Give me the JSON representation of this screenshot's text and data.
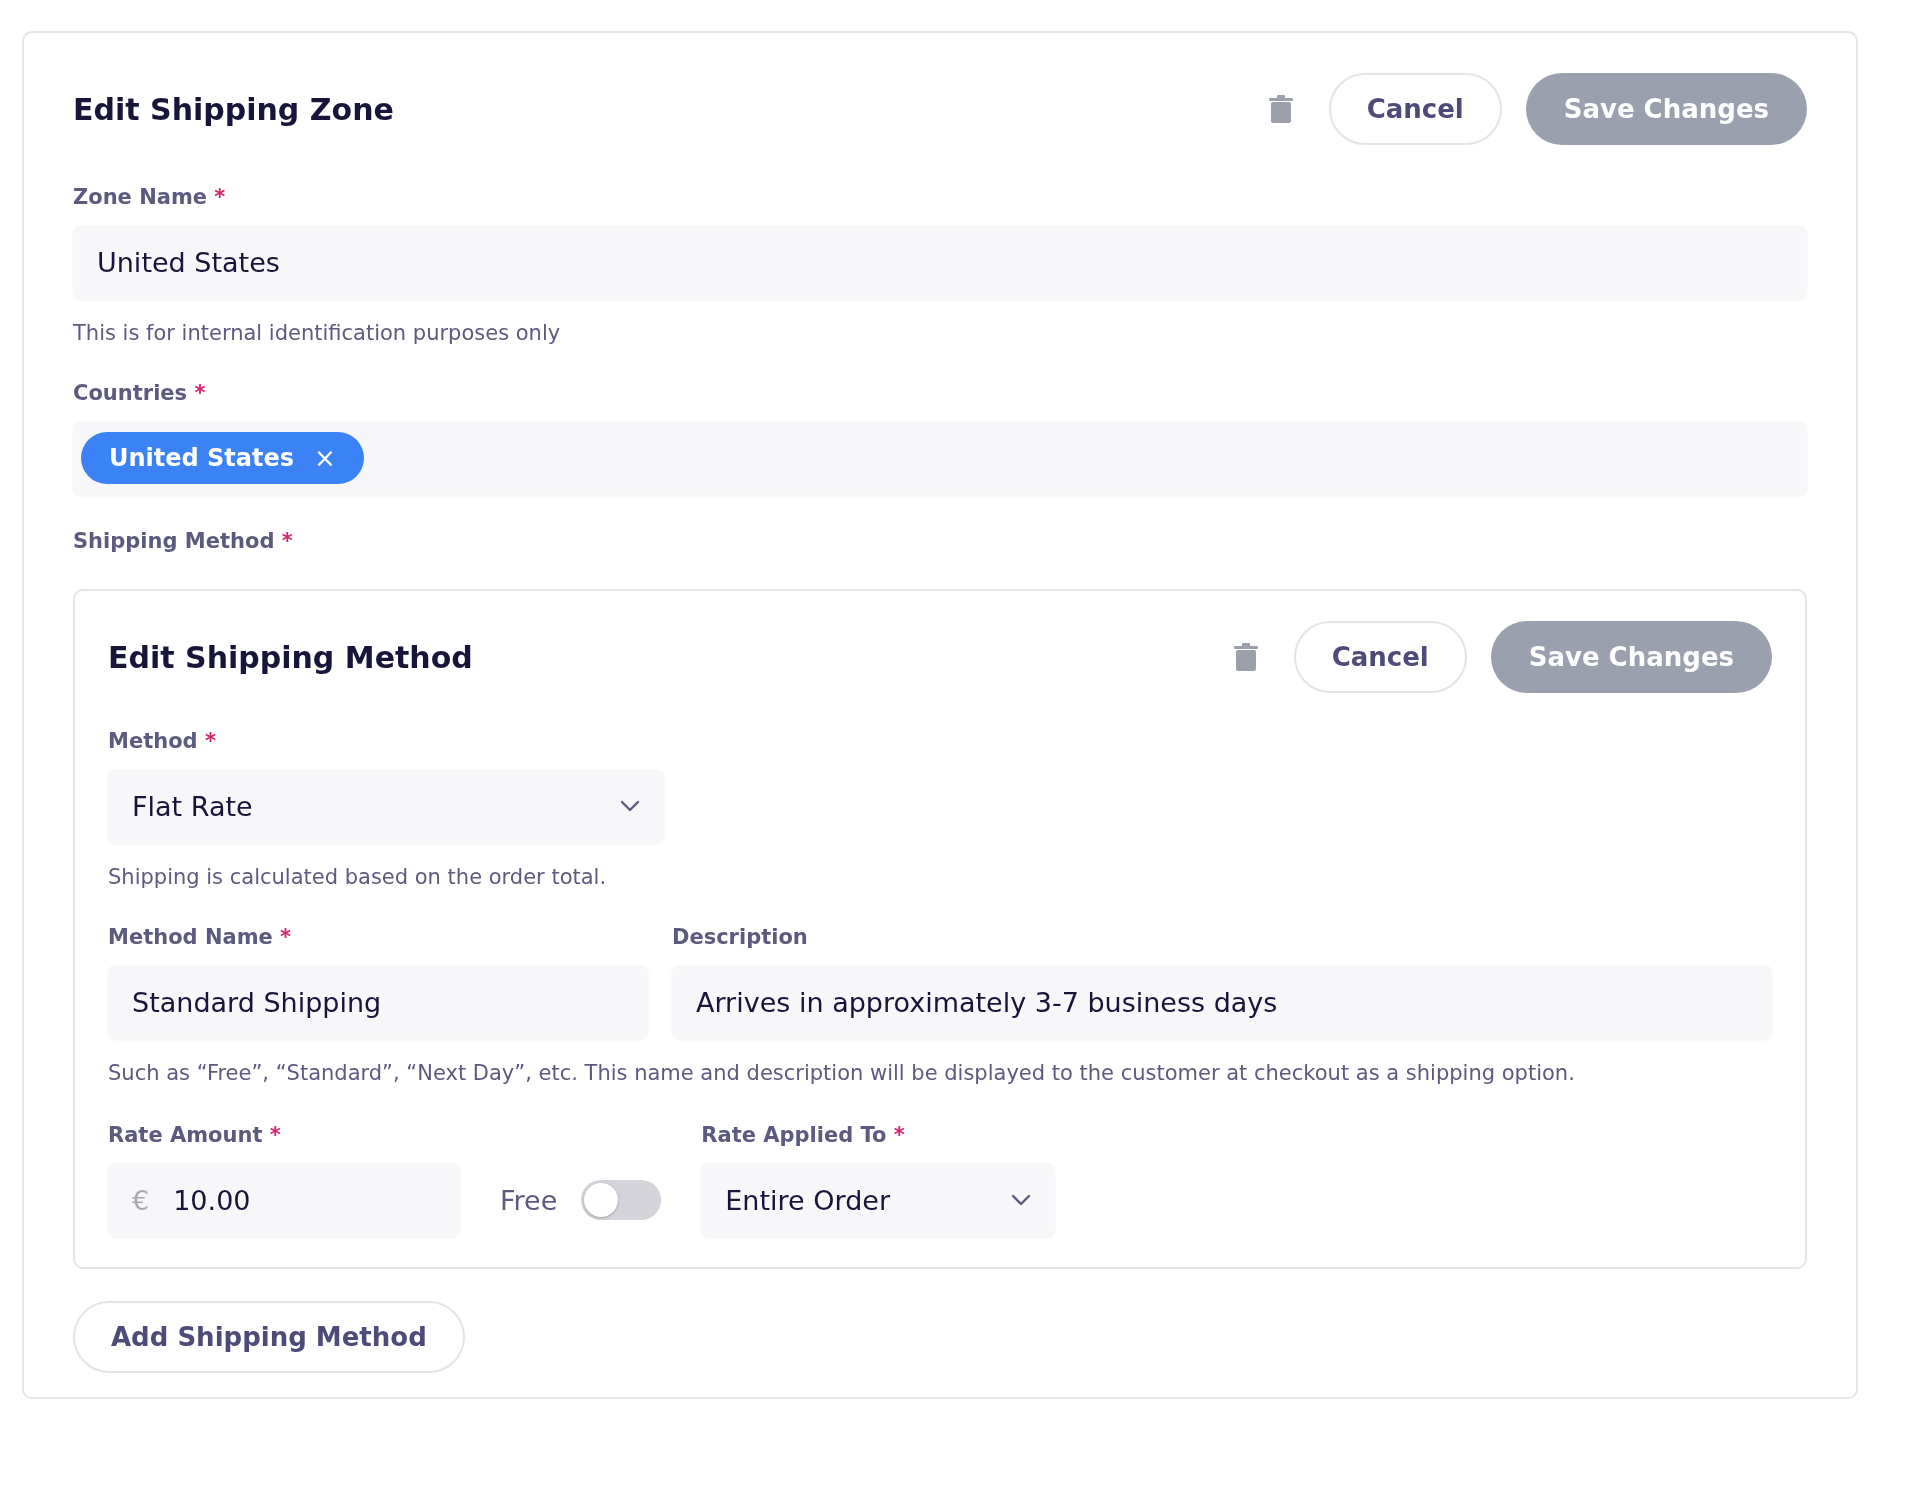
{
  "zone": {
    "title": "Edit Shipping Zone",
    "cancel_label": "Cancel",
    "save": {
      "label": "Save Changes",
      "disabled": true
    }
  },
  "zone_name": {
    "label": "Zone Name",
    "required_mark": "*",
    "value": "United States",
    "help": "This is for internal identification purposes only"
  },
  "countries": {
    "label": "Countries",
    "required_mark": "*",
    "chips": [
      {
        "label": "United States",
        "remove": "×"
      }
    ]
  },
  "shipping_method_label": {
    "label": "Shipping Method",
    "required_mark": "*"
  },
  "method_card": {
    "title": "Edit Shipping Method",
    "cancel_label": "Cancel",
    "save": {
      "label": "Save Changes",
      "disabled": true
    },
    "method": {
      "label": "Method",
      "required_mark": "*",
      "value": "Flat Rate",
      "help": "Shipping is calculated based on the order total."
    },
    "method_name": {
      "label": "Method Name",
      "required_mark": "*",
      "value": "Standard Shipping"
    },
    "description": {
      "label": "Description",
      "value": "Arrives in approximately 3-7 business days"
    },
    "name_help": "Such as “Free”, “Standard”, “Next Day”, etc. This name and description will be displayed to the customer at checkout as a shipping option.",
    "rate_amount": {
      "label": "Rate Amount",
      "required_mark": "*",
      "currency": "€",
      "value": "10.00"
    },
    "free": {
      "label": "Free",
      "on": false
    },
    "rate_applied": {
      "label": "Rate Applied To",
      "required_mark": "*",
      "value": "Entire Order"
    }
  },
  "add_button": "Add Shipping Method"
}
